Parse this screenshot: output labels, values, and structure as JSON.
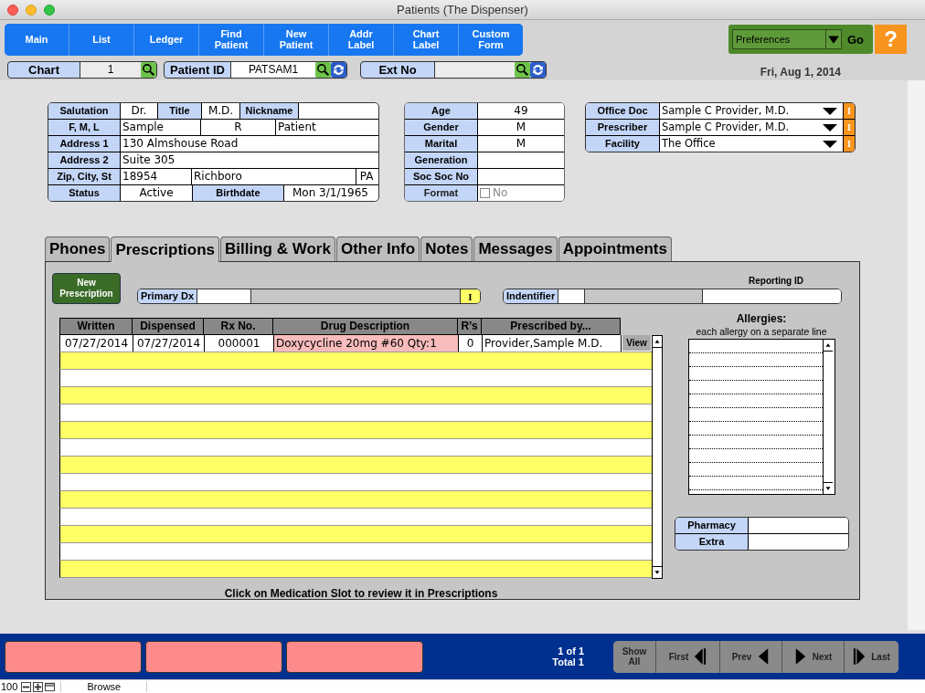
{
  "window": {
    "title": "Patients (The Dispenser)"
  },
  "nav_buttons": [
    {
      "label": "Main"
    },
    {
      "label": "List"
    },
    {
      "label": "Ledger"
    },
    {
      "label": "Find\nPatient"
    },
    {
      "label": "New\nPatient"
    },
    {
      "label": "Addr\nLabel"
    },
    {
      "label": "Chart\nLabel"
    },
    {
      "label": "Custom\nForm"
    }
  ],
  "preferences": {
    "value": "Preferences",
    "go": "Go",
    "help": "?"
  },
  "lookup_fields": [
    {
      "label": "Chart",
      "value": "1",
      "refresh": false
    },
    {
      "label": "Patient ID",
      "value": "PATSAM1",
      "refresh": true
    },
    {
      "label": "Ext No",
      "refresh": true
    }
  ],
  "date": "Fri, Aug 1, 2014",
  "patient_fields": [
    [
      {
        "kind": "label",
        "text": "Salutation"
      },
      {
        "kind": "value",
        "text": "Dr."
      },
      {
        "kind": "label",
        "text": "Title"
      },
      {
        "kind": "value",
        "text": "M.D."
      },
      {
        "kind": "label",
        "text": "Nickname"
      },
      {
        "kind": "value"
      }
    ],
    [
      {
        "kind": "label",
        "text": "F, M, L"
      },
      {
        "kind": "value",
        "text": "Sample"
      },
      {
        "kind": "value",
        "text": "R"
      },
      {
        "kind": "value",
        "text": "Patient"
      }
    ],
    [
      {
        "kind": "label",
        "text": "Address 1"
      },
      {
        "kind": "value",
        "text": "130 Almshouse Road"
      }
    ],
    [
      {
        "kind": "label",
        "text": "Address 2"
      },
      {
        "kind": "value",
        "text": "Suite 305"
      }
    ],
    [
      {
        "kind": "label",
        "text": "Zip, City, St"
      },
      {
        "kind": "value",
        "text": "18954"
      },
      {
        "kind": "value",
        "text": "Richboro"
      },
      {
        "kind": "value",
        "text": "PA"
      }
    ],
    [
      {
        "kind": "label",
        "text": "Status"
      },
      {
        "kind": "value",
        "text": "Active"
      },
      {
        "kind": "label",
        "text": "Birthdate"
      },
      {
        "kind": "value",
        "text": "Mon 3/1/1965"
      }
    ]
  ],
  "details": [
    {
      "kind": "text",
      "label": "Age",
      "value": "49"
    },
    {
      "kind": "text",
      "label": "Gender",
      "value": "M"
    },
    {
      "kind": "text",
      "label": "Marital",
      "value": "M"
    },
    {
      "kind": "text",
      "label": "Generation"
    },
    {
      "kind": "text",
      "label": "Soc Soc No"
    },
    {
      "kind": "checkbox",
      "label": "Format",
      "value": "No",
      "checked": false
    }
  ],
  "providers": [
    {
      "label": "Office Doc",
      "value": "Sample C Provider, M.D.",
      "info": "I"
    },
    {
      "label": "Prescriber",
      "value": "Sample C Provider, M.D.",
      "info": "I"
    },
    {
      "label": "Facility",
      "value": "The Office",
      "info": "I"
    }
  ],
  "tabs": [
    {
      "label": "Phones",
      "selected": false
    },
    {
      "label": "Prescriptions",
      "selected": true
    },
    {
      "label": "Billing & Work",
      "selected": false
    },
    {
      "label": "Other Info",
      "selected": false
    },
    {
      "label": "Notes",
      "selected": false
    },
    {
      "label": "Messages",
      "selected": false
    },
    {
      "label": "Appointments",
      "selected": false
    }
  ],
  "prescriptions": {
    "new_button": "New\nPrescription",
    "primary_dx": {
      "label": "Primary Dx",
      "info": "I"
    },
    "identifier": {
      "label": "Indentifier"
    },
    "reporting_id_label": "Reporting ID",
    "columns": [
      "Written",
      "Dispensed",
      "Rx No.",
      "Drug Description",
      "R’s",
      "Prescribed by..."
    ],
    "rows": [
      {
        "cells": [
          "07/27/2014",
          "07/27/2014",
          "000001",
          "Doxycycline 20mg #60 Qty:1",
          "0",
          "Provider,Sample M.D."
        ],
        "highlighted": true,
        "action": "View"
      }
    ],
    "footer_note": "Click on Medication Slot to review it in Prescriptions"
  },
  "allergies": {
    "title": "Allergies:",
    "hint": "each allergy on a separate line"
  },
  "pharmacy_fields": [
    {
      "label": "Pharmacy"
    },
    {
      "label": "Extra"
    }
  ],
  "record_nav": {
    "position": "1 of 1",
    "total": "Total 1",
    "buttons": [
      {
        "label": "Show\nAll",
        "kind": "show_all"
      },
      {
        "label": "First",
        "kind": "first"
      },
      {
        "label": "Prev",
        "kind": "prev"
      },
      {
        "label": "Next",
        "kind": "next"
      },
      {
        "label": "Last",
        "kind": "last"
      }
    ]
  },
  "status_bar": {
    "zoom": "100",
    "mode": "Browse"
  }
}
